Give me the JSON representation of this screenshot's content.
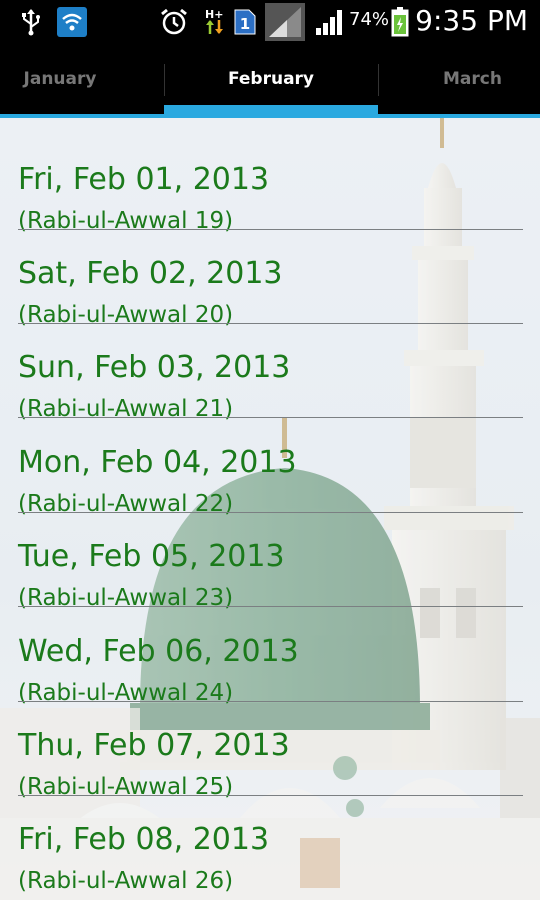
{
  "status_bar": {
    "battery_percent": "74%",
    "time": "9:35 PM",
    "sim_badge": "1",
    "icons": [
      "usb-icon",
      "wifi-app-icon",
      "alarm-icon",
      "data-arrows-icon",
      "sim-icon",
      "signal-icon",
      "battery-icon"
    ]
  },
  "tabs": {
    "prev": "January",
    "current": "February",
    "next": "March"
  },
  "colors": {
    "tab_indicator": "#2aa9e0",
    "date_text": "#1b7a1b"
  },
  "days": [
    {
      "date": "Fri, Feb 01, 2013",
      "hijri": "(Rabi-ul-Awwal 19)"
    },
    {
      "date": "Sat, Feb 02, 2013",
      "hijri": "(Rabi-ul-Awwal 20)"
    },
    {
      "date": "Sun, Feb 03, 2013",
      "hijri": "(Rabi-ul-Awwal 21)"
    },
    {
      "date": "Mon, Feb 04, 2013",
      "hijri": "(Rabi-ul-Awwal 22)"
    },
    {
      "date": "Tue, Feb 05, 2013",
      "hijri": "(Rabi-ul-Awwal 23)"
    },
    {
      "date": "Wed, Feb 06, 2013",
      "hijri": "(Rabi-ul-Awwal 24)"
    },
    {
      "date": "Thu, Feb 07, 2013",
      "hijri": "(Rabi-ul-Awwal 25)"
    },
    {
      "date": "Fri, Feb 08, 2013",
      "hijri": "(Rabi-ul-Awwal 26)"
    }
  ]
}
